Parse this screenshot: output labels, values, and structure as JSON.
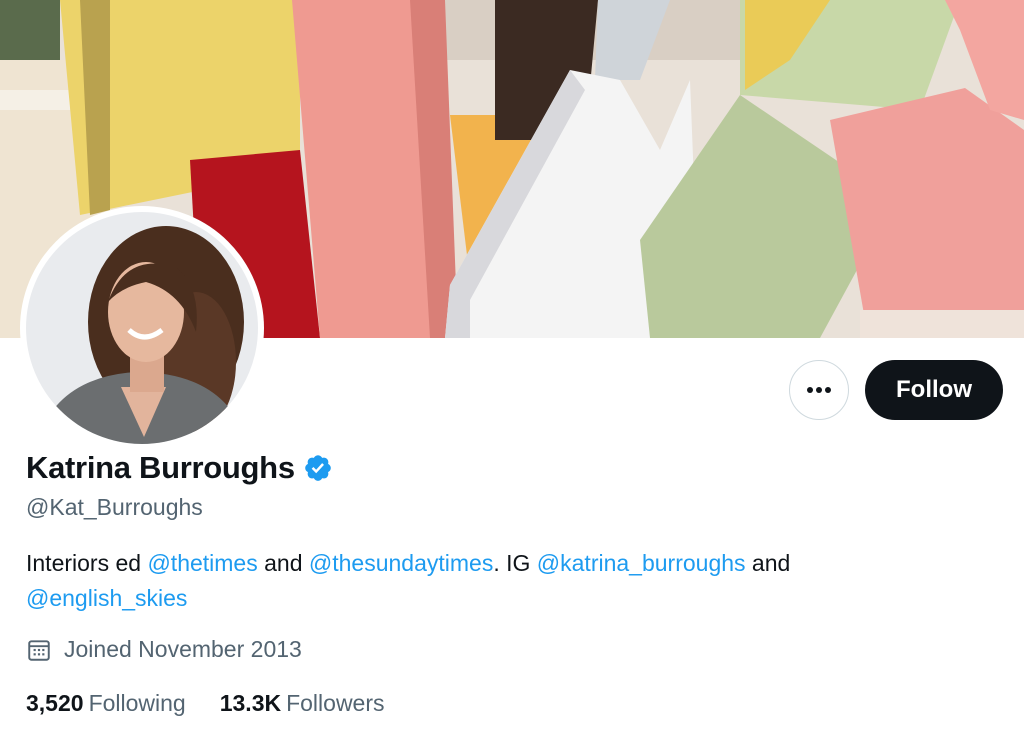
{
  "profile": {
    "name": "Katrina Burroughs",
    "handle": "@Kat_Burroughs",
    "bio": {
      "t1": "Interiors ed ",
      "m1": "@thetimes",
      "t2": " and ",
      "m2": "@thesundaytimes",
      "t3": ". IG ",
      "m3": "@katrina_burroughs",
      "t4": " and",
      "m4": "@english_skies"
    },
    "joined": "Joined November 2013",
    "following_count": "3,520",
    "following_label": "Following",
    "followers_count": "13.3K",
    "followers_label": "Followers"
  },
  "actions": {
    "follow_label": "Follow"
  },
  "icons": {
    "more": "more-icon",
    "verified": "verified-badge-icon",
    "calendar": "calendar-icon"
  },
  "colors": {
    "accent": "#1d9bf0",
    "follow_bg": "#0f1419",
    "secondary_text": "#536471"
  }
}
